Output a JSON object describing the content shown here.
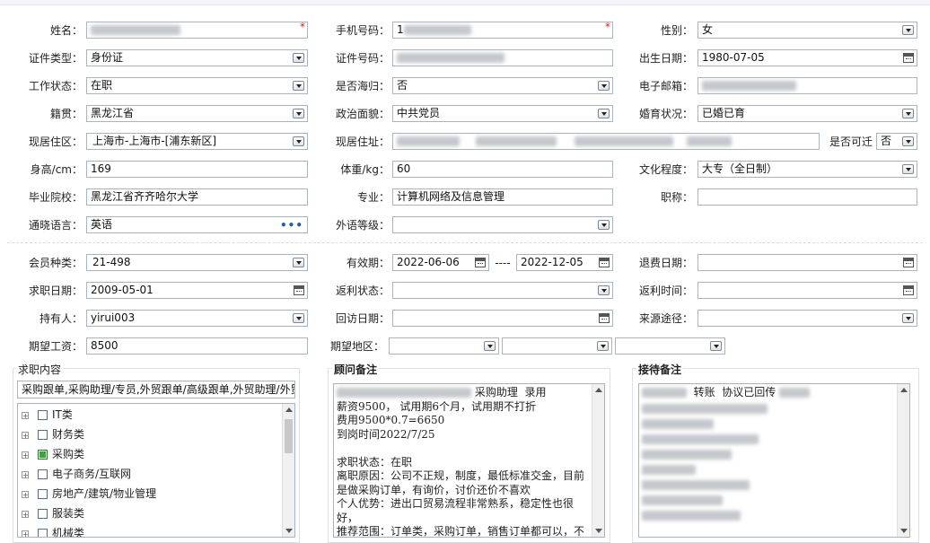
{
  "fields": {
    "name": {
      "label": "姓名："
    },
    "phone": {
      "label": "手机号码：",
      "value": "1"
    },
    "gender": {
      "label": "性别：",
      "value": "女"
    },
    "id_type": {
      "label": "证件类型：",
      "value": "身份证"
    },
    "id_number": {
      "label": "证件号码："
    },
    "birth_date": {
      "label": "出生日期：",
      "value": "1980-07-05"
    },
    "work_status": {
      "label": "工作状态：",
      "value": "在职"
    },
    "returnee": {
      "label": "是否海归：",
      "value": "否"
    },
    "email": {
      "label": "电子邮箱："
    },
    "native_place": {
      "label": "籍贯：",
      "value": "黑龙江省"
    },
    "politics": {
      "label": "政治面貌：",
      "value": "中共党员"
    },
    "marital": {
      "label": "婚育状况：",
      "value": "已婚已育"
    },
    "current_area": {
      "label": "现居住区：",
      "value": "上海市-上海市-[浦东新区]"
    },
    "current_address": {
      "label": "现居住址："
    },
    "relocate": {
      "label": "是否可迁",
      "value": "否"
    },
    "height": {
      "label": "身高/cm：",
      "value": "169"
    },
    "weight": {
      "label": "体重/kg：",
      "value": "60"
    },
    "education": {
      "label": "文化程度：",
      "value": "大专（全日制）"
    },
    "school": {
      "label": "毕业院校：",
      "value": "黑龙江省齐齐哈尔大学"
    },
    "major": {
      "label": "专业：",
      "value": "计算机网络及信息管理"
    },
    "title": {
      "label": "职称："
    },
    "language": {
      "label": "通晓语言：",
      "value": "英语",
      "more": "•••"
    },
    "foreign_level": {
      "label": "外语等级："
    },
    "member_type": {
      "label": "会员种类：",
      "value": "21-498"
    },
    "validity": {
      "label": "有效期：",
      "from": "2022-06-06",
      "sep": "----",
      "to": "2022-12-05"
    },
    "refund_date": {
      "label": "退费日期："
    },
    "job_date": {
      "label": "求职日期：",
      "value": "2009-05-01"
    },
    "rebate_status": {
      "label": "返利状态："
    },
    "rebate_time": {
      "label": "返利时间："
    },
    "holder": {
      "label": "持有人：",
      "value": "yirui003"
    },
    "visit_date": {
      "label": "回访日期："
    },
    "source": {
      "label": "来源途径："
    },
    "salary": {
      "label": "期望工资：",
      "value": "8500"
    },
    "region": {
      "label": "期望地区："
    }
  },
  "job_content": {
    "title": "求职内容",
    "summary": "采购跟单,采购助理/专员,外贸跟单/高级跟单,外贸助理/外贸",
    "tree": [
      {
        "label": "IT类",
        "checked": false
      },
      {
        "label": "财务类",
        "checked": false
      },
      {
        "label": "采购类",
        "checked": true
      },
      {
        "label": "电子商务/互联网",
        "checked": false
      },
      {
        "label": "房地产/建筑/物业管理",
        "checked": false
      },
      {
        "label": "服装类",
        "checked": false
      },
      {
        "label": "机械类",
        "checked": false
      }
    ]
  },
  "consultant_note": {
    "title": "顾问备注",
    "lines": [
      "采购助理  录用",
      "薪资9500， 试用期6个月，试用期不打折",
      "费用9500*0.7=6650",
      "到岗时间2022/7/25",
      "",
      "求职状态：在职",
      "离职原因：公司不正规，制度，最低标准交金，目前",
      "是做采购订单，有询价，讨价还价不喜欢",
      "个人优势：进出口贸易流程非常熟系，稳定性也很",
      "好，",
      "推荐范围：订单类，采购订单，销售订单都可以，不"
    ]
  },
  "reception_note": {
    "title": "接待备注",
    "first_line": "转账  协议已回传"
  },
  "colors": {
    "required": "#d42020",
    "checked": "#3aa63a",
    "border": "#a9b4c2"
  }
}
